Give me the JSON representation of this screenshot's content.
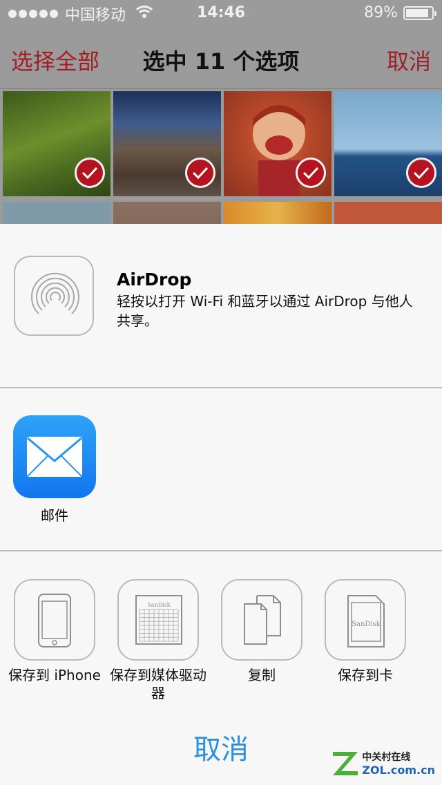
{
  "status_bar": {
    "carrier": "中国移动",
    "time": "14:46",
    "battery_text": "89%",
    "battery_level": 0.89
  },
  "nav": {
    "select_all": "选择全部",
    "title": "选中 11 个选项",
    "cancel": "取消"
  },
  "icons": {
    "check": "checkmark-icon",
    "airdrop": "airdrop-icon",
    "mail": "mail-icon",
    "iphone": "iphone-icon",
    "media_drive": "media-drive-icon",
    "copy": "copy-icon",
    "sd_card": "sd-card-icon"
  },
  "airdrop": {
    "title": "AirDrop",
    "description": "轻按以打开 Wi-Fi 和蓝牙以通过 AirDrop 与他人共享。"
  },
  "apps": [
    {
      "label": "邮件"
    }
  ],
  "actions": [
    {
      "label": "保存到 iPhone"
    },
    {
      "label": "保存到媒体驱动器"
    },
    {
      "label": "复制"
    },
    {
      "label": "保存到卡"
    }
  ],
  "device_brand": "SanDisk",
  "cancel_button": "取消",
  "watermark": {
    "line1": "中关村在线",
    "line2": "ZOL.com.cn"
  },
  "colors": {
    "accent_red": "#a31d24",
    "accent_blue": "#2b8fe0",
    "mail_blue": "#1e8ff5"
  }
}
